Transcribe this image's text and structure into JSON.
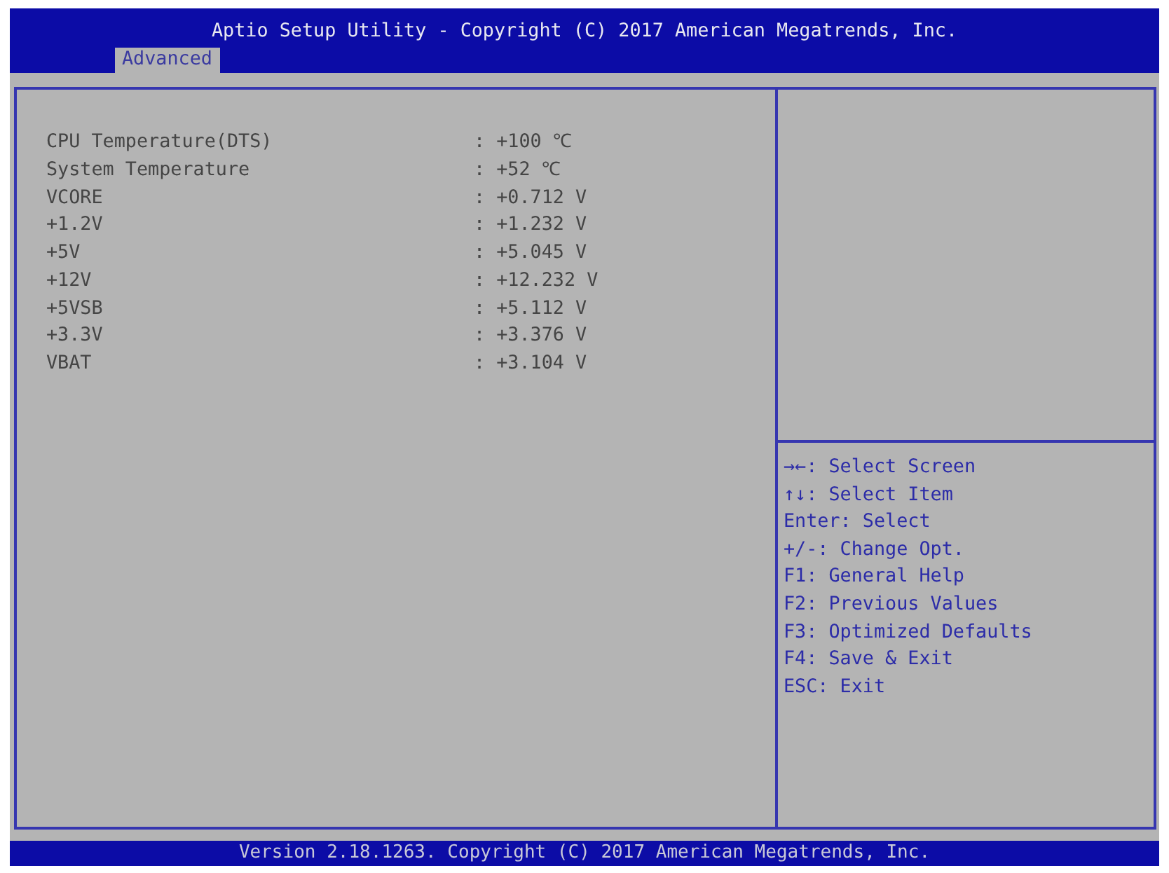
{
  "header": {
    "title": "Aptio Setup Utility - Copyright (C) 2017 American Megatrends, Inc.",
    "tabs": [
      {
        "label": "Advanced",
        "selected": true
      }
    ]
  },
  "readings": [
    {
      "label": "CPU Temperature(DTS)",
      "value": ": +100 ℃"
    },
    {
      "label": "System Temperature",
      "value": ": +52 ℃"
    },
    {
      "label": "VCORE",
      "value": ": +0.712 V"
    },
    {
      "label": "+1.2V",
      "value": ": +1.232 V"
    },
    {
      "label": "+5V",
      "value": ": +5.045 V"
    },
    {
      "label": "+12V",
      "value": ": +12.232 V"
    },
    {
      "label": "+5VSB",
      "value": ": +5.112 V"
    },
    {
      "label": "+3.3V",
      "value": ": +3.376 V"
    },
    {
      "label": "VBAT",
      "value": ": +3.104 V"
    }
  ],
  "help": [
    "→←: Select Screen",
    "↑↓: Select Item",
    "Enter: Select",
    "+/-: Change Opt.",
    "F1: General Help",
    "F2: Previous Values",
    "F3: Optimized Defaults",
    "F4: Save & Exit",
    "ESC: Exit"
  ],
  "footer": "Version 2.18.1263. Copyright (C) 2017 American Megatrends, Inc."
}
